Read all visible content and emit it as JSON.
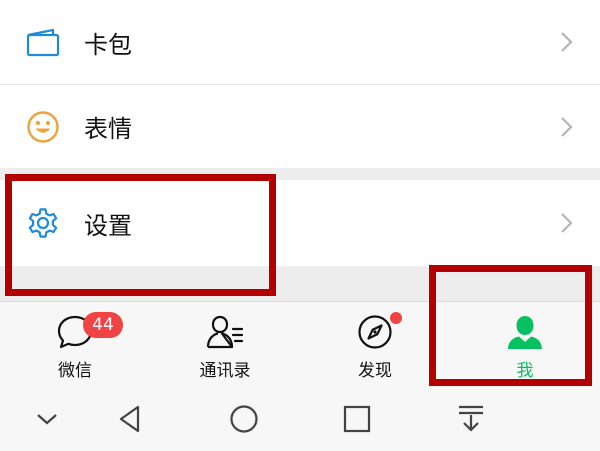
{
  "menu": {
    "cards_label": "卡包",
    "stickers_label": "表情",
    "settings_label": "设置"
  },
  "tabbar": {
    "chats_label": "微信",
    "chats_badge": "44",
    "contacts_label": "通讯录",
    "discover_label": "发现",
    "me_label": "我"
  },
  "colors": {
    "accent_green": "#07c160",
    "highlight_red": "#b30000",
    "icon_blue": "#1f8bd6",
    "icon_orange": "#f0a23a",
    "badge_red": "#f04343"
  },
  "icons": {
    "cards": "card-wallet-icon",
    "stickers": "smiley-icon",
    "settings": "gear-icon",
    "chats": "chat-bubble-icon",
    "contacts": "contacts-icon",
    "discover": "compass-icon",
    "me": "person-icon",
    "nav_hide": "chevron-down-icon",
    "nav_back": "back-triangle-icon",
    "nav_home": "home-circle-icon",
    "nav_recents": "recents-square-icon",
    "nav_notifications": "pull-down-icon"
  }
}
